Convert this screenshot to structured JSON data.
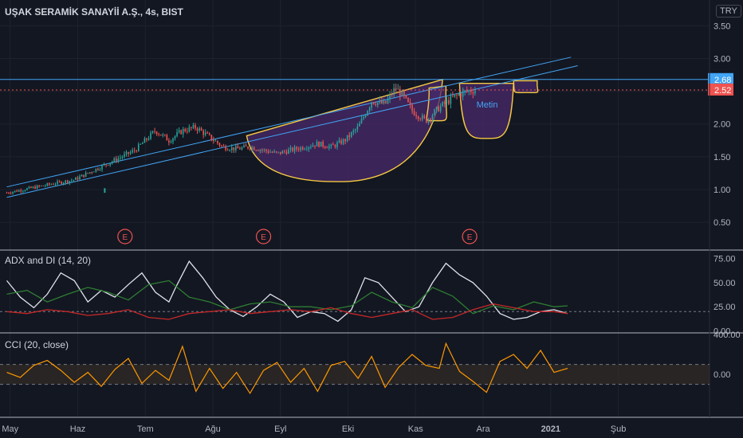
{
  "header": {
    "symbol_title": "UŞAK SERAMİK SANAYİİ A.Ş., 4s, BIST",
    "currency": "TRY"
  },
  "colors": {
    "background": "#131722",
    "grid": "#1e222d",
    "candle_up": "#26a69a",
    "candle_down": "#ef5350",
    "channel_line": "#42a5f5",
    "resistance_line": "#42a5f5",
    "last_price_line": "#ef5350",
    "cup_fill": "#4a2a6b",
    "cup_outline": "#f5c842",
    "adx": "#e0e3eb",
    "di_plus": "#2e7d32",
    "di_minus": "#c62828",
    "cci": "#ff9800",
    "cci_band": "#3a3226",
    "annotation_text": "#42a5f5"
  },
  "chart_data": [
    {
      "type": "candlestick",
      "pane": "price",
      "title": "UŞAK SERAMİK SANAYİİ A.Ş., 4s, BIST",
      "y_ticks": [
        3.5,
        3.0,
        2.5,
        2.0,
        1.5,
        1.0,
        0.5
      ],
      "y_tick_labels": [
        "3.50",
        "3.00",
        "2.50",
        "2.00",
        "1.50",
        "1.00",
        "0.50"
      ],
      "ylim": [
        0.1,
        3.65
      ],
      "x_ticks": [
        {
          "label": "May",
          "t": 0.05
        },
        {
          "label": "Haz",
          "t": 1.05
        },
        {
          "label": "Tem",
          "t": 2.05
        },
        {
          "label": "Ağu",
          "t": 3.05
        },
        {
          "label": "Eyl",
          "t": 4.05
        },
        {
          "label": "Eki",
          "t": 5.05
        },
        {
          "label": "Kas",
          "t": 6.05
        },
        {
          "label": "Ara",
          "t": 7.05
        },
        {
          "label": "2021",
          "t": 8.05
        },
        {
          "label": "Şub",
          "t": 9.05
        }
      ],
      "time_unit": "month index (0 = start of May)",
      "trend_path": [
        [
          0.0,
          0.95
        ],
        [
          0.5,
          1.05
        ],
        [
          1.0,
          1.15
        ],
        [
          1.3,
          1.3
        ],
        [
          1.6,
          1.45
        ],
        [
          1.9,
          1.6
        ],
        [
          2.2,
          1.9
        ],
        [
          2.4,
          1.75
        ],
        [
          2.6,
          1.9
        ],
        [
          2.8,
          1.95
        ],
        [
          3.0,
          1.8
        ],
        [
          3.2,
          1.65
        ],
        [
          3.4,
          1.62
        ],
        [
          3.6,
          1.65
        ],
        [
          3.8,
          1.6
        ],
        [
          4.0,
          1.55
        ],
        [
          4.2,
          1.6
        ],
        [
          4.4,
          1.65
        ],
        [
          4.6,
          1.7
        ],
        [
          4.8,
          1.65
        ],
        [
          5.0,
          1.75
        ],
        [
          5.2,
          1.95
        ],
        [
          5.4,
          2.35
        ],
        [
          5.6,
          2.3
        ],
        [
          5.75,
          2.55
        ],
        [
          5.85,
          2.45
        ],
        [
          6.0,
          2.2
        ],
        [
          6.2,
          2.05
        ],
        [
          6.4,
          2.25
        ],
        [
          6.6,
          2.4
        ],
        [
          6.8,
          2.5
        ],
        [
          6.95,
          2.52
        ]
      ],
      "outlier_bar": {
        "t": 1.45,
        "low": 0.95,
        "high": 1.02
      },
      "last_price": 2.52,
      "last_price_label": "2.52",
      "resistance": 2.68,
      "resistance_label": "2.68",
      "channel": {
        "lower": {
          "start": [
            0.0,
            0.88
          ],
          "end": [
            8.45,
            2.89
          ]
        },
        "upper": {
          "start": [
            0.0,
            1.04
          ],
          "end": [
            8.35,
            3.02
          ]
        }
      },
      "cup": {
        "start": [
          3.55,
          1.82
        ],
        "bottom": [
          4.9,
          1.12
        ],
        "end": [
          6.45,
          2.68
        ]
      },
      "handle_1": {
        "start": [
          6.25,
          2.55
        ],
        "bottom": [
          6.35,
          2.05
        ],
        "end": [
          6.5,
          2.58
        ]
      },
      "handle_2": {
        "start": [
          6.7,
          2.62
        ],
        "bottom": [
          7.1,
          1.78
        ],
        "end": [
          7.5,
          2.62
        ]
      },
      "handle_3": {
        "start": [
          7.5,
          2.66
        ],
        "bottom": [
          7.7,
          2.48
        ],
        "end": [
          7.85,
          2.66
        ]
      },
      "annotation": {
        "text": "Metin",
        "t": 6.95,
        "price": 2.25
      },
      "earnings_markers": [
        {
          "label": "E",
          "t": 1.75
        },
        {
          "label": "E",
          "t": 3.8
        },
        {
          "label": "E",
          "t": 6.85
        }
      ]
    },
    {
      "type": "line",
      "pane": "adx",
      "title": "ADX and DI (14, 20)",
      "y_ticks": [
        75,
        50,
        25,
        0
      ],
      "y_tick_labels": [
        "75.00",
        "50.00",
        "25.00",
        "0.00"
      ],
      "ylim": [
        -2,
        82
      ],
      "reference_value": 20,
      "series": [
        {
          "key": "adx",
          "values": [
            [
              0.0,
              52
            ],
            [
              0.2,
              35
            ],
            [
              0.4,
              24
            ],
            [
              0.6,
              38
            ],
            [
              0.8,
              60
            ],
            [
              1.0,
              52
            ],
            [
              1.2,
              30
            ],
            [
              1.4,
              42
            ],
            [
              1.6,
              35
            ],
            [
              1.8,
              48
            ],
            [
              2.0,
              60
            ],
            [
              2.2,
              40
            ],
            [
              2.4,
              30
            ],
            [
              2.5,
              45
            ],
            [
              2.7,
              72
            ],
            [
              2.9,
              55
            ],
            [
              3.1,
              35
            ],
            [
              3.3,
              22
            ],
            [
              3.5,
              15
            ],
            [
              3.7,
              25
            ],
            [
              3.9,
              38
            ],
            [
              4.1,
              30
            ],
            [
              4.3,
              14
            ],
            [
              4.5,
              20
            ],
            [
              4.7,
              18
            ],
            [
              4.9,
              10
            ],
            [
              5.1,
              22
            ],
            [
              5.3,
              55
            ],
            [
              5.5,
              50
            ],
            [
              5.7,
              35
            ],
            [
              5.9,
              20
            ],
            [
              6.1,
              25
            ],
            [
              6.3,
              50
            ],
            [
              6.5,
              70
            ],
            [
              6.7,
              58
            ],
            [
              6.9,
              50
            ],
            [
              7.1,
              36
            ],
            [
              7.3,
              18
            ],
            [
              7.5,
              12
            ],
            [
              7.7,
              14
            ],
            [
              7.9,
              20
            ],
            [
              8.1,
              22
            ],
            [
              8.3,
              18
            ]
          ]
        },
        {
          "key": "di_plus",
          "values": [
            [
              0.0,
              38
            ],
            [
              0.3,
              42
            ],
            [
              0.6,
              30
            ],
            [
              0.9,
              38
            ],
            [
              1.2,
              45
            ],
            [
              1.5,
              40
            ],
            [
              1.8,
              32
            ],
            [
              2.1,
              48
            ],
            [
              2.4,
              52
            ],
            [
              2.7,
              35
            ],
            [
              3.0,
              30
            ],
            [
              3.3,
              22
            ],
            [
              3.6,
              28
            ],
            [
              3.9,
              30
            ],
            [
              4.2,
              25
            ],
            [
              4.5,
              25
            ],
            [
              4.8,
              22
            ],
            [
              5.1,
              26
            ],
            [
              5.4,
              40
            ],
            [
              5.7,
              30
            ],
            [
              6.0,
              24
            ],
            [
              6.3,
              45
            ],
            [
              6.6,
              36
            ],
            [
              6.9,
              18
            ],
            [
              7.2,
              26
            ],
            [
              7.5,
              22
            ],
            [
              7.8,
              30
            ],
            [
              8.1,
              25
            ],
            [
              8.3,
              26
            ]
          ]
        },
        {
          "key": "di_minus",
          "values": [
            [
              0.0,
              20
            ],
            [
              0.3,
              18
            ],
            [
              0.6,
              22
            ],
            [
              0.9,
              20
            ],
            [
              1.2,
              16
            ],
            [
              1.5,
              18
            ],
            [
              1.8,
              22
            ],
            [
              2.1,
              14
            ],
            [
              2.4,
              12
            ],
            [
              2.7,
              18
            ],
            [
              3.0,
              20
            ],
            [
              3.3,
              22
            ],
            [
              3.6,
              18
            ],
            [
              3.9,
              20
            ],
            [
              4.2,
              22
            ],
            [
              4.5,
              20
            ],
            [
              4.8,
              24
            ],
            [
              5.1,
              18
            ],
            [
              5.4,
              14
            ],
            [
              5.7,
              18
            ],
            [
              6.0,
              22
            ],
            [
              6.3,
              12
            ],
            [
              6.6,
              14
            ],
            [
              6.9,
              22
            ],
            [
              7.2,
              28
            ],
            [
              7.5,
              24
            ],
            [
              7.8,
              20
            ],
            [
              8.1,
              20
            ],
            [
              8.3,
              18
            ]
          ]
        }
      ]
    },
    {
      "type": "line",
      "pane": "cci",
      "title": "CCI (20, close)",
      "y_ticks": [
        400,
        0
      ],
      "y_tick_labels": [
        "400.00",
        "0.00"
      ],
      "ylim": [
        -430,
        400
      ],
      "band": [
        -100,
        100
      ],
      "series": [
        {
          "key": "cci",
          "values": [
            [
              0.0,
              20
            ],
            [
              0.2,
              -30
            ],
            [
              0.4,
              90
            ],
            [
              0.6,
              140
            ],
            [
              0.8,
              40
            ],
            [
              1.0,
              -80
            ],
            [
              1.2,
              20
            ],
            [
              1.4,
              -120
            ],
            [
              1.6,
              50
            ],
            [
              1.8,
              160
            ],
            [
              2.0,
              -90
            ],
            [
              2.2,
              40
            ],
            [
              2.4,
              -60
            ],
            [
              2.6,
              280
            ],
            [
              2.8,
              -170
            ],
            [
              3.0,
              60
            ],
            [
              3.2,
              -140
            ],
            [
              3.4,
              20
            ],
            [
              3.6,
              -190
            ],
            [
              3.8,
              40
            ],
            [
              4.0,
              120
            ],
            [
              4.2,
              -80
            ],
            [
              4.4,
              60
            ],
            [
              4.6,
              -170
            ],
            [
              4.8,
              90
            ],
            [
              5.0,
              130
            ],
            [
              5.2,
              -40
            ],
            [
              5.4,
              180
            ],
            [
              5.6,
              -130
            ],
            [
              5.8,
              70
            ],
            [
              6.0,
              200
            ],
            [
              6.2,
              90
            ],
            [
              6.4,
              60
            ],
            [
              6.5,
              310
            ],
            [
              6.7,
              30
            ],
            [
              6.9,
              -70
            ],
            [
              7.1,
              -180
            ],
            [
              7.3,
              130
            ],
            [
              7.5,
              200
            ],
            [
              7.7,
              60
            ],
            [
              7.9,
              240
            ],
            [
              8.1,
              20
            ],
            [
              8.3,
              60
            ]
          ]
        }
      ]
    }
  ]
}
